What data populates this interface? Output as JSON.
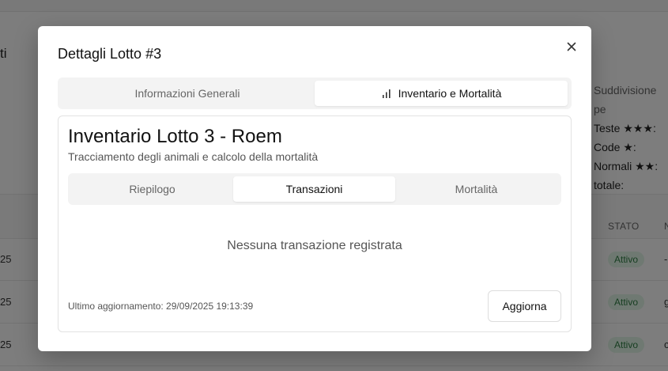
{
  "background": {
    "page_title_partial": "ti",
    "summary": {
      "title": "Suddivisione pe",
      "lines": [
        "Teste ★★★:",
        "Code ★:",
        "Normali ★★:",
        "totale:"
      ]
    },
    "table": {
      "headers": [
        "STATO",
        "N"
      ],
      "rows": [
        {
          "date": "25",
          "status": "Attivo",
          "tail": "-"
        },
        {
          "date": "25",
          "status": "Attivo",
          "tail": "g"
        },
        {
          "date": "25",
          "status": "Attivo",
          "tail": "c"
        }
      ]
    }
  },
  "modal": {
    "title": "Dettagli Lotto #3",
    "close_icon": "close-icon",
    "tabs": [
      {
        "label": "Informazioni Generali",
        "active": false
      },
      {
        "label": "Inventario e Mortalità",
        "active": true,
        "icon": "bar-chart-icon"
      }
    ],
    "inventory": {
      "title": "Inventario Lotto 3 - Roem",
      "subtitle": "Tracciamento degli animali e calcolo della mortalità",
      "tabs": [
        {
          "label": "Riepilogo",
          "active": false
        },
        {
          "label": "Transazioni",
          "active": true
        },
        {
          "label": "Mortalità",
          "active": false
        }
      ],
      "empty_message": "Nessuna transazione registrata",
      "last_updated": "Ultimo aggiornamento: 29/09/2025 19:13:39",
      "refresh_label": "Aggiorna"
    }
  }
}
